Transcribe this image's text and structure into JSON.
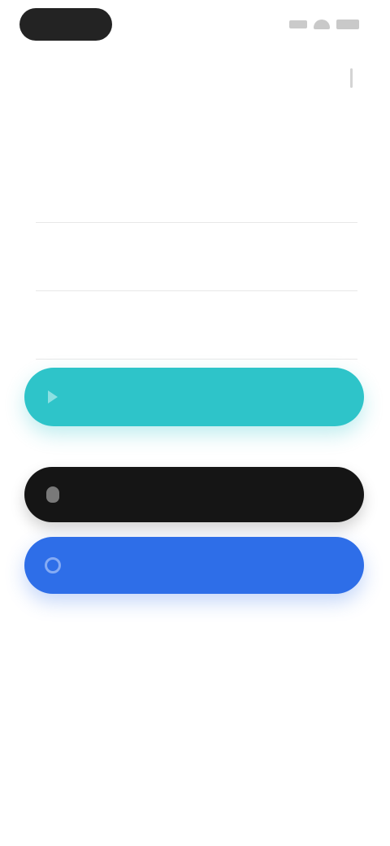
{
  "header": {
    "title": "",
    "action_icon": "more-icon"
  },
  "form": {
    "fields": [
      {
        "label": ""
      },
      {
        "label": ""
      },
      {
        "label": ""
      }
    ]
  },
  "buttons": {
    "primary_label": "",
    "apple_label": "",
    "google_label": ""
  },
  "colors": {
    "primary": "#2ec4c9",
    "apple": "#151515",
    "google": "#2e6ee8",
    "status_pill": "#232323"
  }
}
